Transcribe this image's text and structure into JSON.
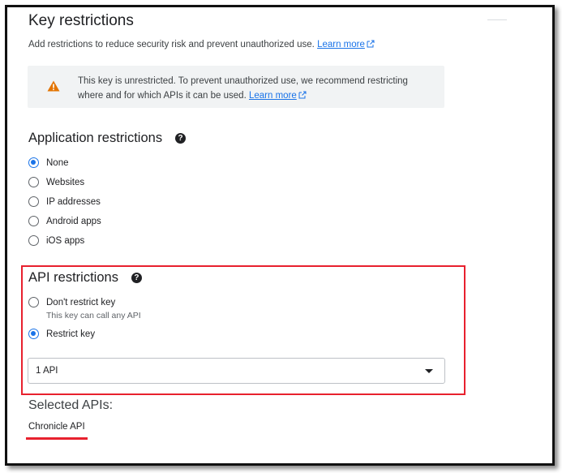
{
  "key_restrictions": {
    "title": "Key restrictions",
    "description": "Add restrictions to reduce security risk and prevent unauthorized use.",
    "learn_more": "Learn more"
  },
  "warning": {
    "icon": "warning-icon",
    "text": "This key is unrestricted. To prevent unauthorized use, we recommend restricting where and for which APIs it can be used.",
    "learn_more": "Learn more"
  },
  "application_restrictions": {
    "title": "Application restrictions",
    "options": [
      {
        "label": "None",
        "checked": true
      },
      {
        "label": "Websites",
        "checked": false
      },
      {
        "label": "IP addresses",
        "checked": false
      },
      {
        "label": "Android apps",
        "checked": false
      },
      {
        "label": "iOS apps",
        "checked": false
      }
    ]
  },
  "api_restrictions": {
    "title": "API restrictions",
    "dont_restrict": {
      "label": "Don't restrict key",
      "sublabel": "This key can call any API",
      "checked": false
    },
    "restrict": {
      "label": "Restrict key",
      "checked": true
    },
    "dropdown_value": "1 API"
  },
  "selected_apis": {
    "title": "Selected APIs:",
    "items": [
      "Chronicle API"
    ]
  },
  "colors": {
    "accent": "#1a73e8",
    "highlight": "#e8212e",
    "warning": "#e37400"
  }
}
